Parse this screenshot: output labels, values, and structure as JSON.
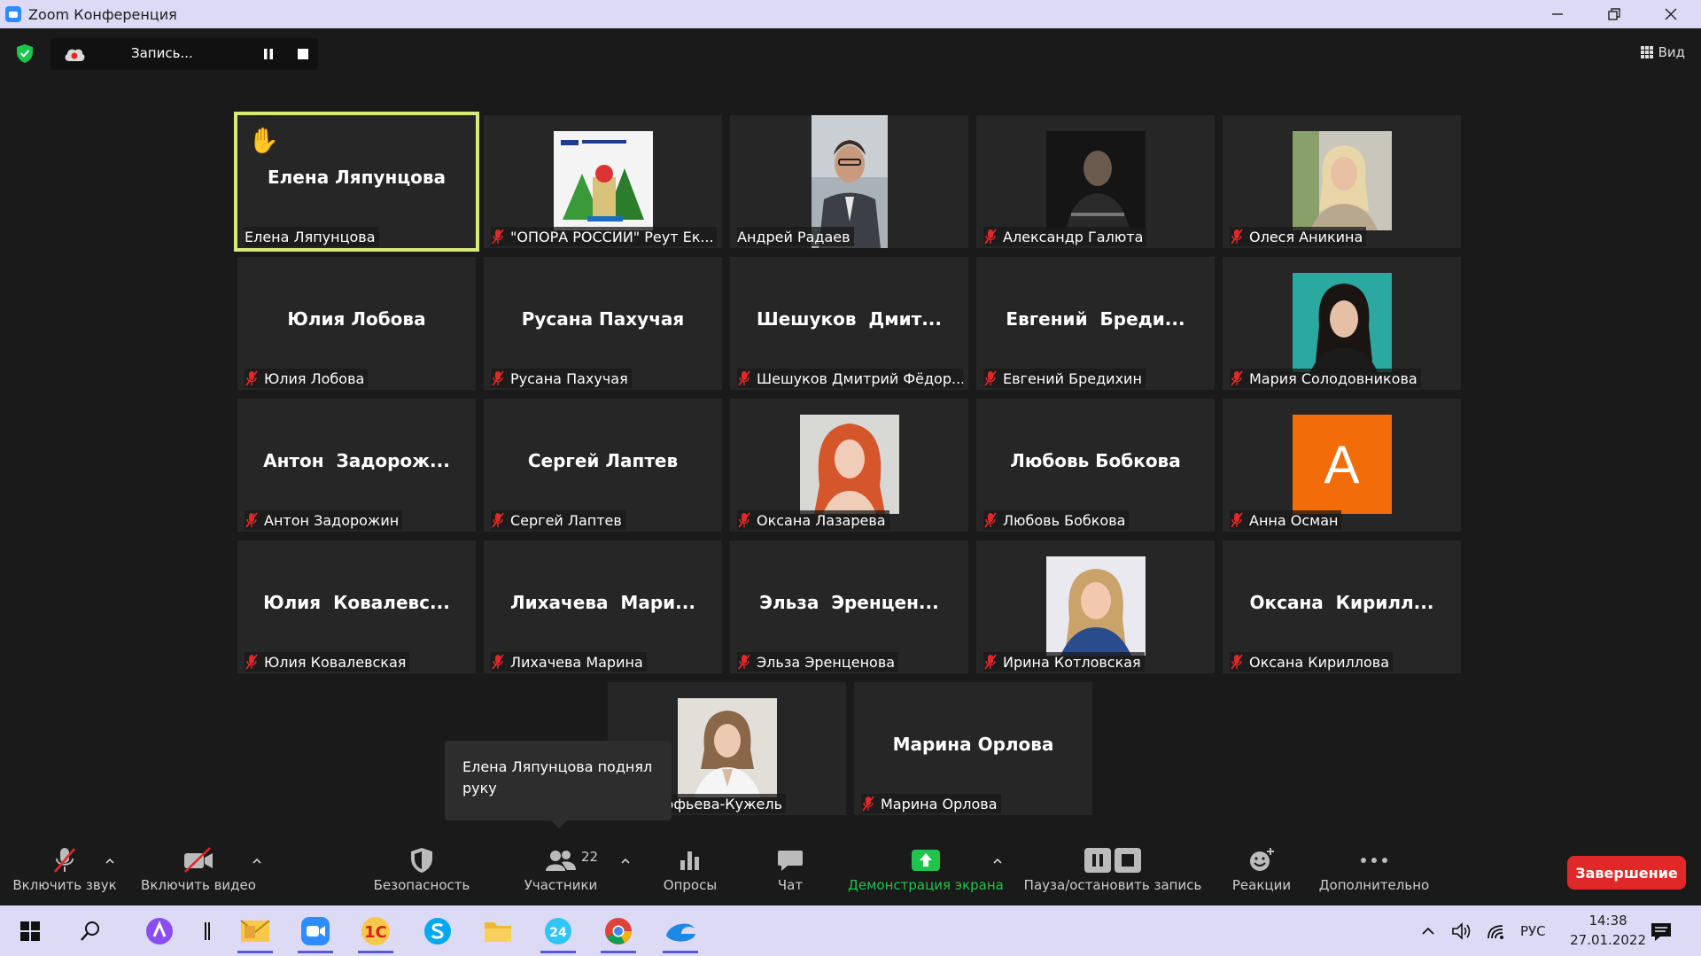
{
  "window": {
    "title": "Zoom Конференция"
  },
  "recording": {
    "label": "Запись..."
  },
  "view": {
    "label": "Вид"
  },
  "participants": [
    {
      "big": "Елена Ляпунцова",
      "label": "Елена Ляпунцова",
      "muted": false,
      "thumb": "none",
      "hand": true
    },
    {
      "big": "",
      "label": "\"ОПОРА РОССИИ\" Реут Ек...",
      "muted": true,
      "thumb": "opora-logo"
    },
    {
      "big": "",
      "label": "Андрей Радаев",
      "muted": false,
      "thumb": "video-man"
    },
    {
      "big": "",
      "label": "Александр Галюта",
      "muted": true,
      "thumb": "photo-dark"
    },
    {
      "big": "",
      "label": "Олеся Аникина",
      "muted": true,
      "thumb": "photo-blonde"
    },
    {
      "big": "Юлия Лобова",
      "label": "Юлия Лобова",
      "muted": true,
      "thumb": "none"
    },
    {
      "big": "Русана Пахучая",
      "label": "Русана Пахучая",
      "muted": true,
      "thumb": "none"
    },
    {
      "big": "Шешуков  Дмит...",
      "label": "Шешуков Дмитрий Фёдор...",
      "muted": true,
      "thumb": "none"
    },
    {
      "big": "Евгений  Бреди...",
      "label": "Евгений Бредихин",
      "muted": true,
      "thumb": "none"
    },
    {
      "big": "",
      "label": "Мария Солодовникова",
      "muted": true,
      "thumb": "photo-brunette"
    },
    {
      "big": "Антон  Задорож...",
      "label": "Антон Задорожин",
      "muted": true,
      "thumb": "none"
    },
    {
      "big": "Сергей Лаптев",
      "label": "Сергей Лаптев",
      "muted": true,
      "thumb": "none"
    },
    {
      "big": "",
      "label": "Оксана Лазарева",
      "muted": true,
      "thumb": "photo-redhair"
    },
    {
      "big": "Любовь Бобкова",
      "label": "Любовь Бобкова",
      "muted": true,
      "thumb": "none"
    },
    {
      "big": "",
      "label": "Анна Осман",
      "muted": true,
      "thumb": "avatar-letter",
      "letter": "A"
    },
    {
      "big": "Юлия  Ковалевс...",
      "label": "Юлия Ковалевская",
      "muted": true,
      "thumb": "none"
    },
    {
      "big": "Лихачева  Мари...",
      "label": "Лихачева Марина",
      "muted": true,
      "thumb": "none"
    },
    {
      "big": "Эльза  Эренцен...",
      "label": "Эльза Эренценова",
      "muted": true,
      "thumb": "none"
    },
    {
      "big": "",
      "label": "Ирина Котловская",
      "muted": true,
      "thumb": "photo-blonde2"
    },
    {
      "big": "Оксана  Кирилл...",
      "label": "Оксана Кириллова",
      "muted": true,
      "thumb": "none"
    },
    {
      "big": "",
      "label": "а Прокофьева-Кужель",
      "muted": false,
      "thumb": "photo-woman"
    },
    {
      "big": "Марина Орлова",
      "label": "Марина Орлова",
      "muted": true,
      "thumb": "none"
    }
  ],
  "tooltip": {
    "text": "Елена Ляпунцова поднял руку"
  },
  "toolbar": {
    "audio": "Включить звук",
    "video": "Включить видео",
    "security": "Безопасность",
    "participants": "Участники",
    "participants_count": "22",
    "polls": "Опросы",
    "chat": "Чат",
    "share": "Демонстрация экрана",
    "record": "Пауза/остановить запись",
    "reactions": "Реакции",
    "more": "Дополнительно",
    "end": "Завершение"
  },
  "taskbar": {
    "lang": "РУС",
    "time": "14:38",
    "date": "27.01.2022",
    "app_1c": "1С",
    "app_b24": "24"
  },
  "colors": {
    "accent_green": "#1ec54d",
    "end_red": "#e02828",
    "active_border": "#d9e87b",
    "avatar_orange": "#f26d0a"
  }
}
